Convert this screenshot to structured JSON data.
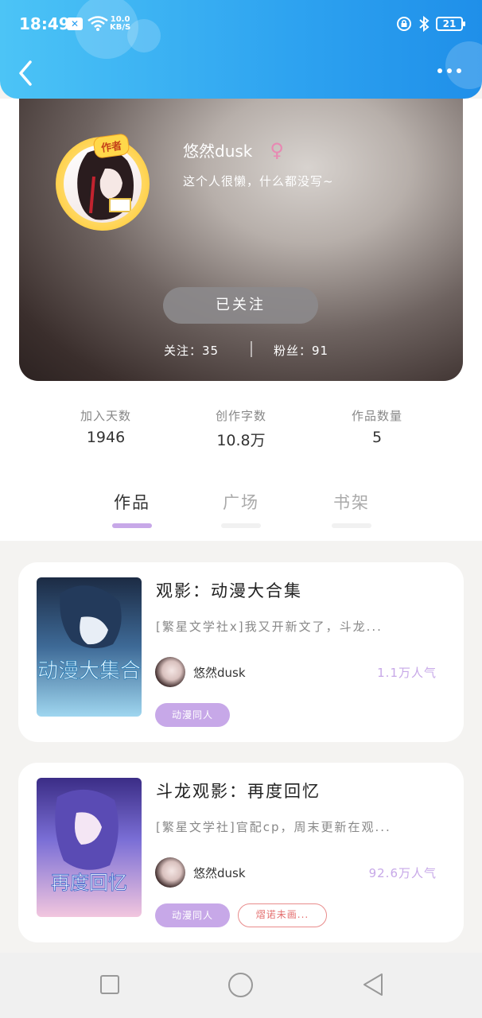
{
  "status_bar": {
    "time": "18:49",
    "speed_top": "10.0",
    "speed_unit": "KB/S",
    "battery": "21"
  },
  "header": {
    "back_icon": "chevron-left-icon",
    "more_icon": "more-dots-icon"
  },
  "profile": {
    "author_tag": "作者",
    "username": "悠然dusk",
    "gender_symbol": "♀",
    "bio": "这个人很懒，什么都没写~",
    "follow_button": "已关注",
    "following": "关注：35",
    "fans": "粉丝：91"
  },
  "stats": [
    {
      "label": "加入天数",
      "value": "1946"
    },
    {
      "label": "创作字数",
      "value": "10.8万"
    },
    {
      "label": "作品数量",
      "value": "5"
    }
  ],
  "tabs": [
    {
      "label": "作品",
      "active": true
    },
    {
      "label": "广场",
      "active": false
    },
    {
      "label": "书架",
      "active": false
    }
  ],
  "works": [
    {
      "title": "观影：动漫大合集",
      "description": "[繁星文学社x]我又开新文了，斗龙...",
      "author": "悠然dusk",
      "popularity": "1.1万人气",
      "cover_text": "动漫大集合",
      "tags": [
        "动漫同人"
      ]
    },
    {
      "title": "斗龙观影：再度回忆",
      "description": "[繁星文学社]官配cp，周末更新在观...",
      "author": "悠然dusk",
      "popularity": "92.6万人气",
      "cover_text": "再度回忆",
      "tags": [
        "动漫同人",
        "熠诺未画..."
      ]
    }
  ],
  "colors": {
    "header": "#2ea3f0",
    "accent_purple": "#c7a8e8",
    "tag_outline": "#e98c8c"
  }
}
